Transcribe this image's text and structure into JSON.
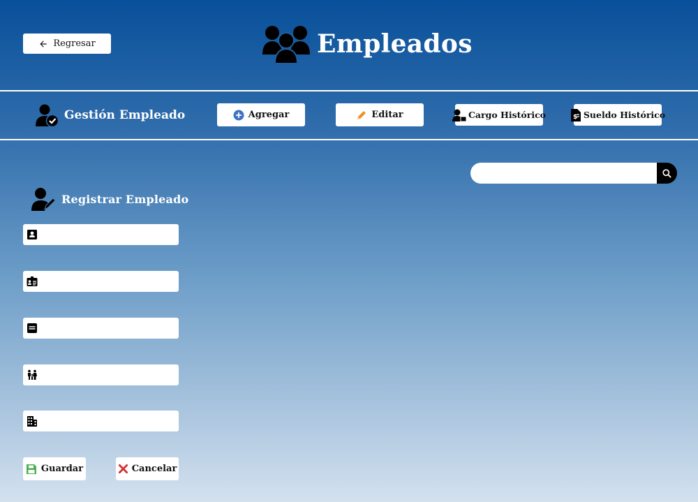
{
  "header": {
    "back_label": "Regresar",
    "title": "Empleados",
    "title_icon": "people-group-icon"
  },
  "toolbar": {
    "section_label": "Gestión Empleado",
    "section_icon": "user-check-icon",
    "buttons": [
      {
        "label": "Agregar",
        "icon": "plus-circle-icon",
        "color": "#3f72c4"
      },
      {
        "label": "Editar",
        "icon": "pencil-icon",
        "color": "#f0902a"
      },
      {
        "label": "Cargo Histórico",
        "icon": "user-tie-icon",
        "color": "#000000"
      },
      {
        "label": "Sueldo Histórico",
        "icon": "salary-doc-icon",
        "color": "#000000"
      }
    ]
  },
  "search": {
    "placeholder": "",
    "value": "",
    "icon": "search-icon"
  },
  "form": {
    "title": "Registrar Empleado",
    "title_icon": "user-edit-icon",
    "fields": [
      {
        "icon": "contact-card-icon",
        "value": "",
        "placeholder": ""
      },
      {
        "icon": "id-badge-icon",
        "value": "",
        "placeholder": ""
      },
      {
        "icon": "form-icon",
        "value": "",
        "placeholder": ""
      },
      {
        "icon": "family-icon",
        "value": "",
        "placeholder": ""
      },
      {
        "icon": "building-icon",
        "value": "",
        "placeholder": ""
      }
    ],
    "save_label": "Guardar",
    "save_icon": "floppy-disk-icon",
    "save_color": "#4caf50",
    "cancel_label": "Cancelar",
    "cancel_icon": "x-mark-icon",
    "cancel_color": "#d32f2f"
  }
}
